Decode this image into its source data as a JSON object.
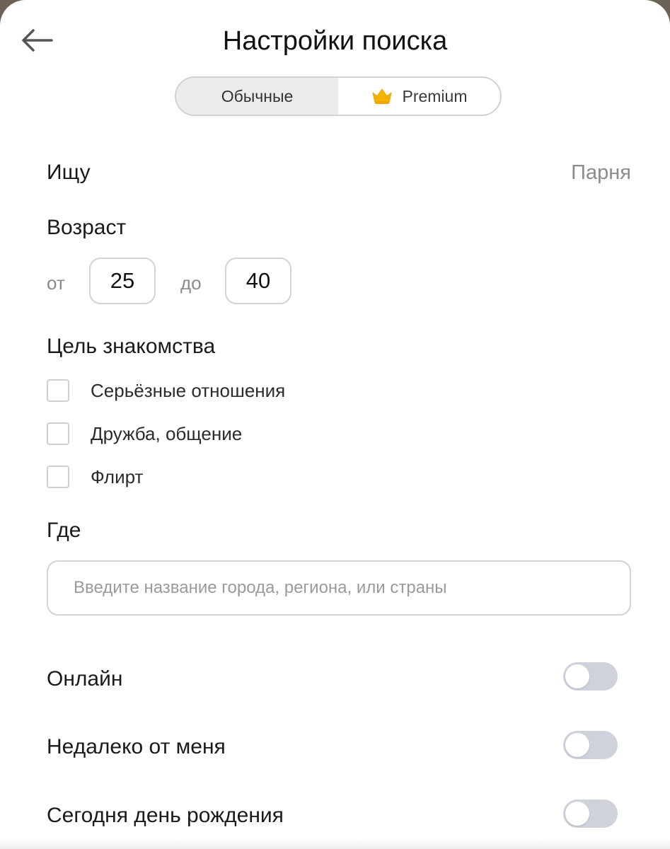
{
  "header": {
    "title": "Настройки поиска",
    "back_icon": "arrow-left-icon"
  },
  "mode_tabs": [
    {
      "label": "Обычные",
      "active": true
    },
    {
      "label": "Premium",
      "icon": "crown-icon",
      "active": false
    }
  ],
  "seeking": {
    "label": "Ищу",
    "value": "Парня"
  },
  "age": {
    "label": "Возраст",
    "from_label": "от",
    "from_value": "25",
    "to_label": "до",
    "to_value": "40"
  },
  "purpose": {
    "label": "Цель знакомства",
    "options": [
      {
        "label": "Серьёзные отношения",
        "checked": false
      },
      {
        "label": "Дружба, общение",
        "checked": false
      },
      {
        "label": "Флирт",
        "checked": false
      }
    ]
  },
  "location": {
    "label": "Где",
    "value": "",
    "placeholder": "Введите название города, региона, или страны"
  },
  "toggles": [
    {
      "label": "Онлайн",
      "on": false
    },
    {
      "label": "Недалеко от меня",
      "on": false
    },
    {
      "label": "Сегодня день рождения",
      "on": false
    }
  ],
  "colors": {
    "crown": "#F5B400",
    "toggle_off": "#CFD2DA",
    "active_segment": "#ECECEC"
  }
}
